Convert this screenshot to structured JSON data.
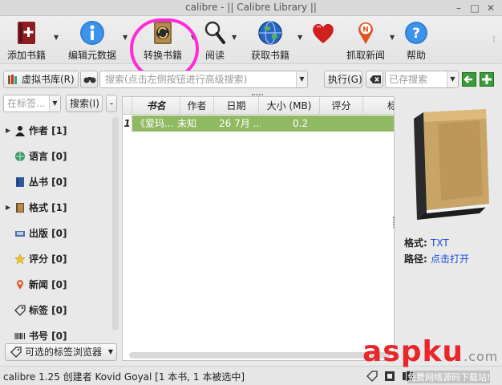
{
  "window": {
    "title": "calibre - || Calibre Library ||"
  },
  "toolbar": {
    "add_books": "添加书籍",
    "edit_metadata": "编辑元数据",
    "convert_books": "转换书籍",
    "read": "阅读",
    "get_books": "获取书籍",
    "fetch_news": "抓取新闻",
    "help": "帮助"
  },
  "searchbar": {
    "virtual_library": "虚拟书库(R)",
    "search_placeholder": "搜索(点击左侧按钮进行高级搜索)",
    "execute": "执行(G)",
    "saved_search_placeholder": "已存搜索"
  },
  "tag_browser": {
    "find_placeholder": "在标签...",
    "search_button": "搜索(I)",
    "minus": "-",
    "items": [
      {
        "label": "作者 [1]",
        "expandable": true,
        "icon": "person-icon"
      },
      {
        "label": "语言 [0]",
        "expandable": false,
        "icon": "language-icon"
      },
      {
        "label": "丛书 [0]",
        "expandable": false,
        "icon": "series-icon"
      },
      {
        "label": "格式 [1]",
        "expandable": true,
        "icon": "format-icon"
      },
      {
        "label": "出版 [0]",
        "expandable": false,
        "icon": "publisher-icon"
      },
      {
        "label": "评分 [0]",
        "expandable": false,
        "icon": "star-icon"
      },
      {
        "label": "新闻 [0]",
        "expandable": false,
        "icon": "news-icon"
      },
      {
        "label": "标签 [0]",
        "expandable": false,
        "icon": "tag-icon"
      },
      {
        "label": "书号 [0]",
        "expandable": false,
        "icon": "barcode-icon"
      }
    ],
    "alt_browser": "可选的标签浏览器"
  },
  "book_table": {
    "columns": [
      "书名",
      "作者",
      "日期",
      "大小 (MB)",
      "评分",
      "标"
    ],
    "rows": [
      {
        "num": "1",
        "title": "《爱玛...",
        "author": "未知",
        "date": "26  7月 ...",
        "size": "0.2",
        "rating": ""
      }
    ]
  },
  "details": {
    "format_label": "格式:",
    "format_value": "TXT",
    "path_label": "路径:",
    "path_value": "点击打开"
  },
  "status": {
    "text": "calibre 1.25 创建者 Kovid Goyal  [1 本书, 1 本被选中]"
  },
  "watermark": {
    "main": "aspku",
    "suffix": ".com",
    "sub": "免费网络源码下载站!"
  },
  "colors": {
    "selected_row": "#8fba63",
    "highlight_circle": "#ff2bd8",
    "link": "#1a4fd6"
  }
}
